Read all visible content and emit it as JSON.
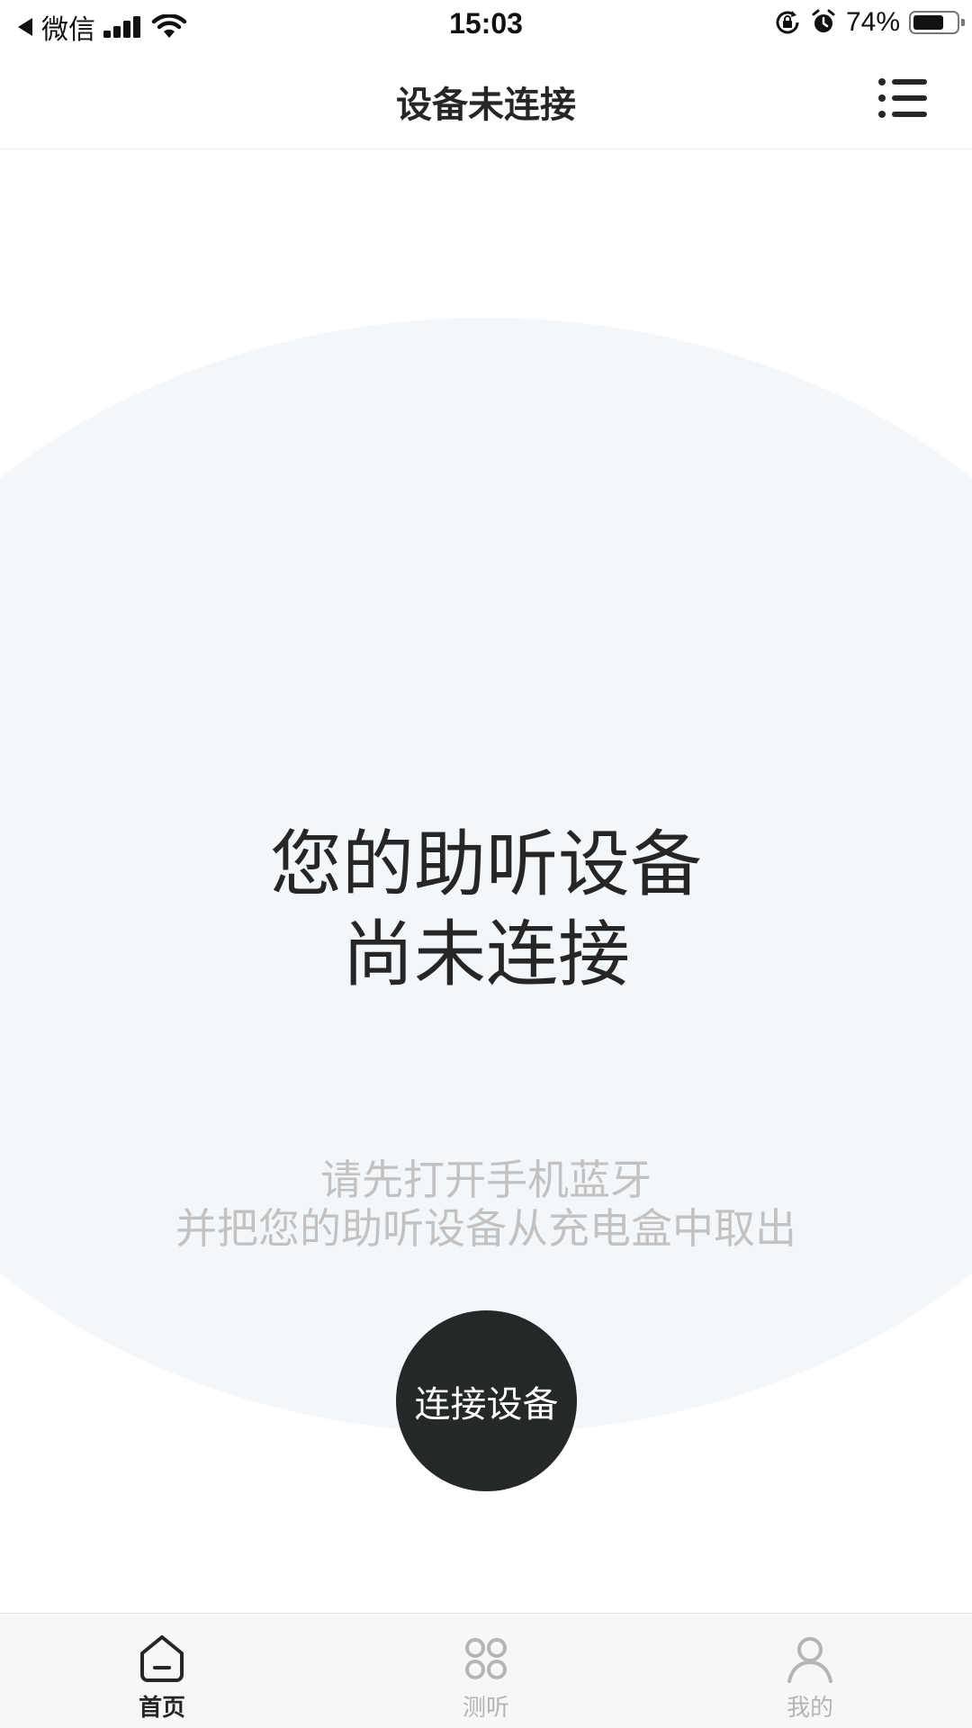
{
  "status_bar": {
    "back_app": "微信",
    "time": "15:03",
    "battery_percent": "74%",
    "battery_level": 0.74
  },
  "nav": {
    "title": "设备未连接"
  },
  "main": {
    "headline_line1": "您的助听设备",
    "headline_line2": "尚未连接",
    "hint_line1": "请先打开手机蓝牙",
    "hint_line2": "并把您的助听设备从充电盒中取出",
    "connect_button": "连接设备"
  },
  "tabs": [
    {
      "label": "首页",
      "icon": "home-icon",
      "active": true
    },
    {
      "label": "测听",
      "icon": "hearing-test-icon",
      "active": false
    },
    {
      "label": "我的",
      "icon": "profile-icon",
      "active": false
    }
  ],
  "colors": {
    "primary_dark": "#252829",
    "circle_bg": "#f4f7fa",
    "hint_text": "#c2c2c2",
    "tab_inactive": "#b5b5b5"
  }
}
